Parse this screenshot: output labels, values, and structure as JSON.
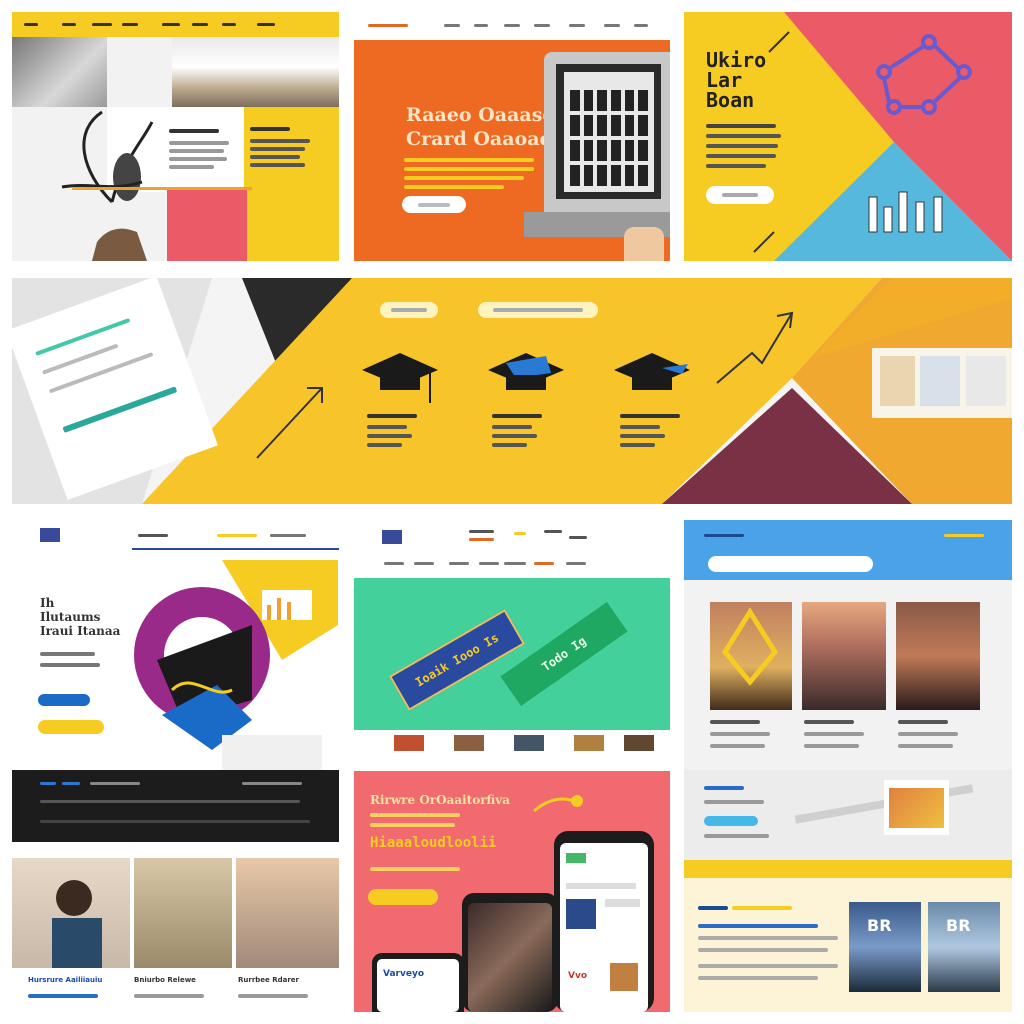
{
  "colors": {
    "yellow": "#f7cc22",
    "orange": "#ee6a22",
    "pink": "#ea5a67",
    "blue": "#4aa3dd",
    "teal": "#44c890",
    "dark": "#1f1f1f",
    "maroon": "#7a3145"
  },
  "tiles": {
    "t2": {
      "headline_1": "Raaeo Oaaasolar",
      "headline_2": "Crard Oaaoaeianna",
      "button": "—"
    },
    "t3": {
      "title_1": "Ukiro",
      "title_2": "Lar",
      "title_3": "Boan"
    },
    "t5": {
      "title_1": "Ih",
      "title_2": "Ilutaums",
      "title_3": "Iraui Itanaa"
    },
    "t6": {
      "banner_1": "Ioaik Iooo Is",
      "banner_2": "Todo Ig"
    },
    "t8": {
      "headline_1": "Rirwre OrOaaitorfiva",
      "headline_2": "Hiaaaloudloolii",
      "phone_text": "Varveyo",
      "card_text": "Vvo"
    },
    "t9": {
      "caption_1": "Hursrure Aailiiauiu",
      "caption_2": "Bniurbo Relewe",
      "caption_3": "Rurrbee Rdarer"
    },
    "t7": {
      "title_1": "BR",
      "title_2": "BR"
    }
  }
}
